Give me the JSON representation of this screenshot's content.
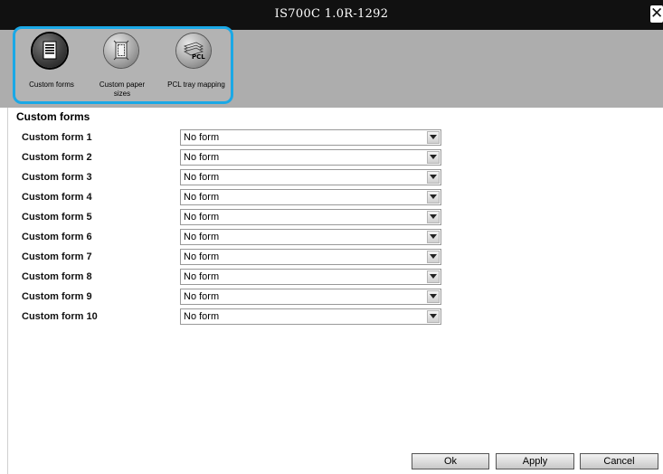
{
  "window": {
    "title": "IS700C 1.0R-1292",
    "close_glyph": "✕"
  },
  "toolbar": {
    "tools": [
      {
        "label": "Custom forms",
        "icon": "document-icon",
        "active": true
      },
      {
        "label": "Custom paper sizes",
        "icon": "paper-size-icon",
        "active": false
      },
      {
        "label": "PCL tray mapping",
        "icon": "pcl-tray-icon",
        "active": false
      }
    ],
    "accent": "#1aa8e6"
  },
  "section": {
    "title": "Custom forms"
  },
  "forms": [
    {
      "label": "Custom form 1",
      "value": "No form"
    },
    {
      "label": "Custom form 2",
      "value": "No form"
    },
    {
      "label": "Custom form 3",
      "value": "No form"
    },
    {
      "label": "Custom form 4",
      "value": "No form"
    },
    {
      "label": "Custom form 5",
      "value": "No form"
    },
    {
      "label": "Custom form 6",
      "value": "No form"
    },
    {
      "label": "Custom form 7",
      "value": "No form"
    },
    {
      "label": "Custom form 8",
      "value": "No form"
    },
    {
      "label": "Custom form 9",
      "value": "No form"
    },
    {
      "label": "Custom form 10",
      "value": "No form"
    }
  ],
  "buttons": {
    "ok": "Ok",
    "apply": "Apply",
    "cancel": "Cancel"
  }
}
